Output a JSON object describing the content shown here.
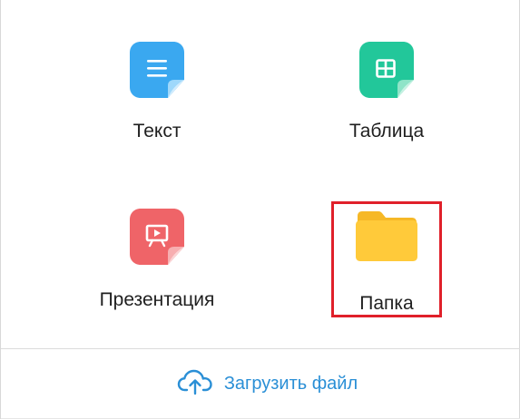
{
  "create_menu": {
    "items": [
      {
        "label": "Текст",
        "icon": "text-document-icon",
        "color": "#3aa8f0"
      },
      {
        "label": "Таблица",
        "icon": "spreadsheet-icon",
        "color": "#22c79a"
      },
      {
        "label": "Презентация",
        "icon": "presentation-icon",
        "color": "#ef6468"
      },
      {
        "label": "Папка",
        "icon": "folder-icon",
        "color": "#ffc93a"
      }
    ],
    "highlighted_item": "Папка"
  },
  "upload": {
    "label": "Загрузить файл",
    "icon": "cloud-upload-icon",
    "color": "#2a8fd6"
  }
}
